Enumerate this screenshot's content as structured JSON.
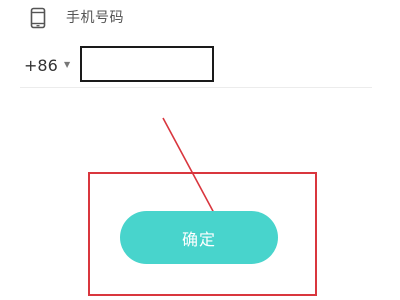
{
  "phone_section": {
    "icon": "phone-icon",
    "label": "手机号码",
    "country_code": "+86",
    "dropdown_icon": "caret-down-icon",
    "input_value": "",
    "input_placeholder": ""
  },
  "actions": {
    "confirm_label": "确定"
  },
  "colors": {
    "button_background": "#48d4cc",
    "button_text": "#ffffff",
    "annotation": "#d9363e",
    "input_border": "#1a1a1a"
  }
}
